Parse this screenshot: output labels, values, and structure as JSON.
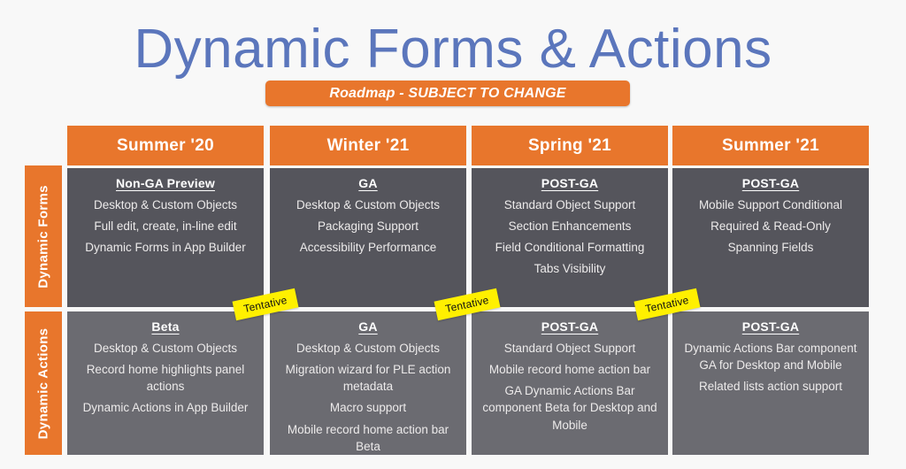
{
  "header": {
    "title": "Dynamic Forms & Actions",
    "banner_label": "Roadmap - SUBJECT TO CHANGE",
    "title_color": "#5b76bc",
    "banner_color": "#e8762c"
  },
  "table": {
    "accent_color": "#e8762c",
    "row1_cell_color": "#55555c",
    "row2_cell_color": "#6b6b71",
    "background_color": "#f8f8f8",
    "columns": [
      {
        "header": "Summer '20"
      },
      {
        "header": "Winter '21"
      },
      {
        "header": "Spring '21"
      },
      {
        "header": "Summer '21"
      }
    ],
    "rows": [
      {
        "label": "Dynamic Forms",
        "cells": [
          {
            "status": "Non-GA Preview",
            "items": [
              "Desktop & Custom Objects",
              "Full edit, create, in-line edit",
              "Dynamic Forms in App Builder"
            ]
          },
          {
            "status": "GA",
            "items": [
              "Desktop & Custom Objects",
              "Packaging Support",
              "Accessibility Performance"
            ]
          },
          {
            "status": "POST-GA",
            "items": [
              "Standard Object Support",
              "Section Enhancements",
              "Field Conditional Formatting",
              "Tabs Visibility"
            ]
          },
          {
            "status": "POST-GA",
            "items": [
              "Mobile Support Conditional",
              "Required & Read-Only",
              "Spanning Fields"
            ]
          }
        ]
      },
      {
        "label": "Dynamic Actions",
        "cells": [
          {
            "status": "Beta",
            "items": [
              "Desktop & Custom Objects",
              "Record home highlights panel actions",
              "Dynamic Actions in App Builder"
            ]
          },
          {
            "status": "GA",
            "items": [
              "Desktop & Custom Objects",
              "Migration wizard for PLE action metadata",
              "Macro support",
              "Mobile record home action bar Beta"
            ]
          },
          {
            "status": "POST-GA",
            "items": [
              "Standard Object Support",
              "Mobile record home action bar",
              "GA Dynamic Actions Bar component Beta for Desktop and Mobile"
            ]
          },
          {
            "status": "POST-GA",
            "items": [
              "Dynamic Actions Bar component GA for Desktop and Mobile",
              "Related lists action support"
            ]
          }
        ]
      }
    ]
  },
  "tentative_tags": [
    {
      "label": "Tentative"
    },
    {
      "label": "Tentative"
    },
    {
      "label": "Tentative"
    }
  ]
}
